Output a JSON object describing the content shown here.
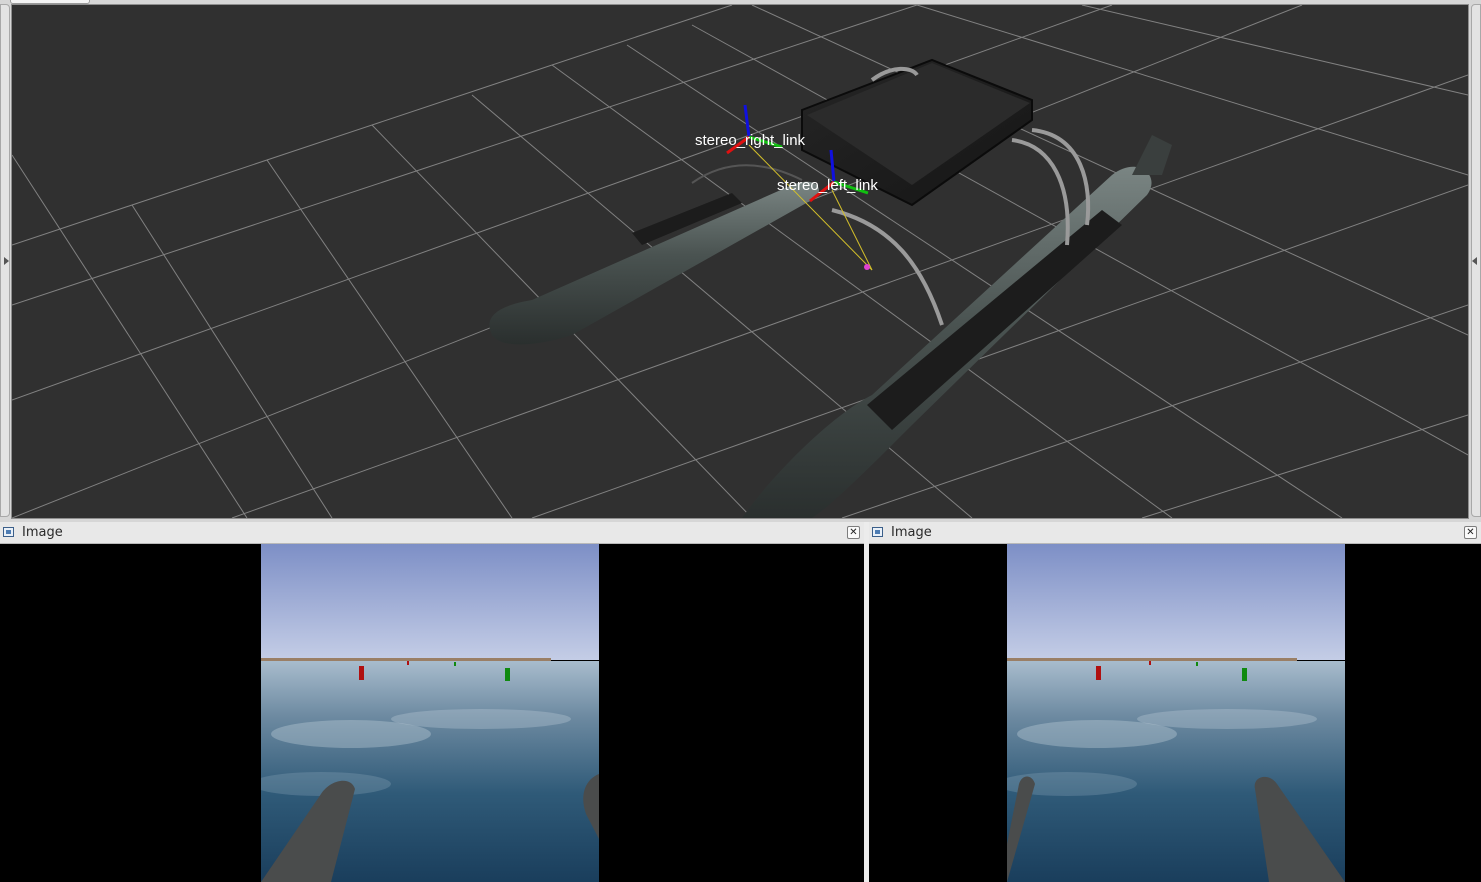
{
  "viewport_3d": {
    "frame_labels": {
      "stereo_right": "stereo_right_link",
      "stereo_left": "stereo_left_link"
    },
    "background_color": "#303030",
    "grid_color": "#a0a0a0",
    "axis_colors": {
      "x": "#e01010",
      "y": "#10c010",
      "z": "#1010e0"
    }
  },
  "image_panels": [
    {
      "title": "Image",
      "close_icon": "close-icon"
    },
    {
      "title": "Image",
      "close_icon": "close-icon"
    }
  ]
}
